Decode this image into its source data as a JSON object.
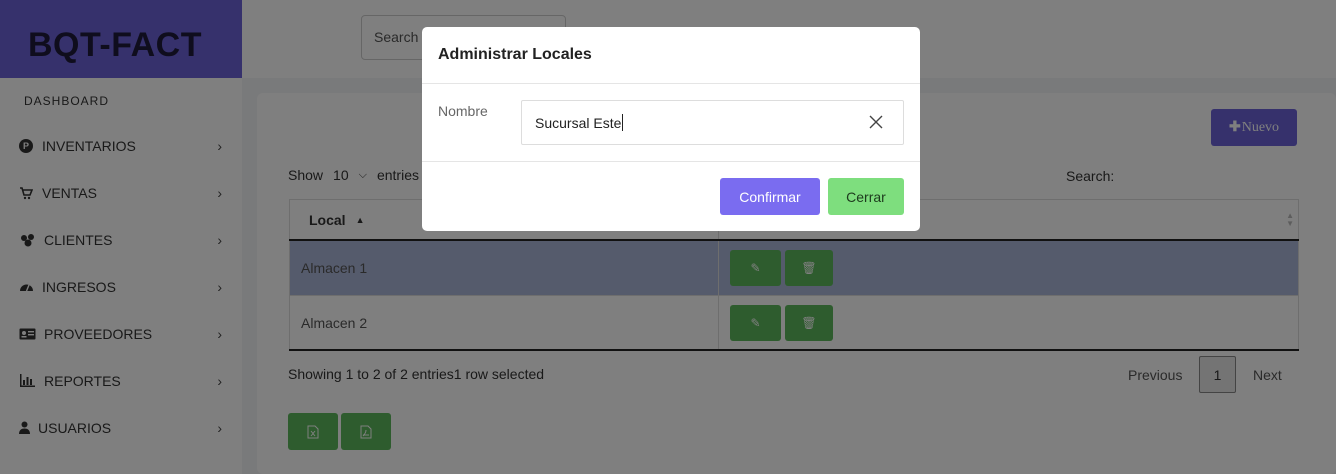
{
  "app": {
    "brand": "BQT-FACT"
  },
  "topbar": {
    "search_placeholder": "Search"
  },
  "sidebar": {
    "dashboard_label": "DASHBOARD",
    "items": [
      {
        "label": "INVENTARIOS",
        "icon": "p-circle-icon"
      },
      {
        "label": "VENTAS",
        "icon": "cart-icon"
      },
      {
        "label": "CLIENTES",
        "icon": "users-icon"
      },
      {
        "label": "INGRESOS",
        "icon": "gauge-icon"
      },
      {
        "label": "PROVEEDORES",
        "icon": "id-card-icon"
      },
      {
        "label": "REPORTES",
        "icon": "bar-chart-icon"
      },
      {
        "label": "USUARIOS",
        "icon": "user-icon"
      }
    ]
  },
  "content": {
    "new_button": "Nuevo",
    "show_label": "Show",
    "entries_value": "10",
    "entries_label": "entries",
    "search_label": "Search:",
    "table": {
      "headers": [
        "Local",
        ""
      ],
      "rows": [
        {
          "local": "Almacen 1",
          "selected": true
        },
        {
          "local": "Almacen 2",
          "selected": false
        }
      ]
    },
    "info": "Showing 1 to 2 of 2 entries1 row selected",
    "pagination": {
      "previous": "Previous",
      "current": "1",
      "next": "Next"
    }
  },
  "modal": {
    "title": "Administrar Locales",
    "field_label": "Nombre",
    "field_value": "Sucursal Este",
    "confirm_label": "Confirmar",
    "close_label": "Cerrar"
  },
  "colors": {
    "brand": "#6c63d9",
    "selected_row": "#aab6d8",
    "action_green": "#5cb85c",
    "confirm": "#7a6cf0",
    "close": "#7ede7e"
  }
}
